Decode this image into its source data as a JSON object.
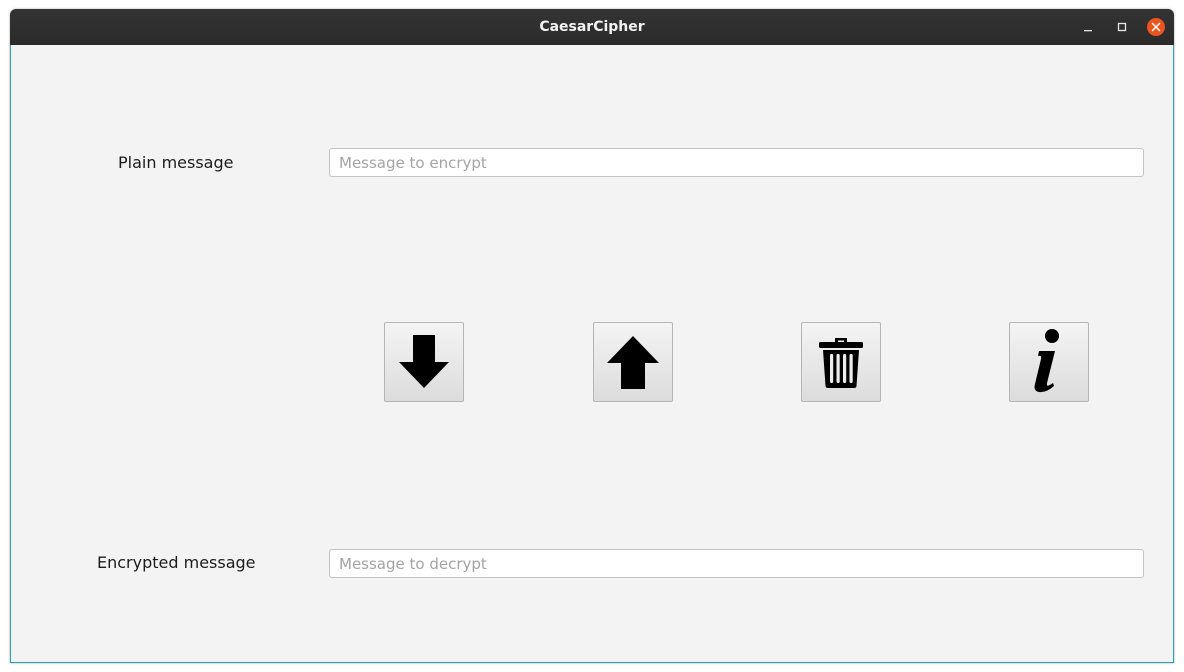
{
  "window": {
    "title": "CaesarCipher",
    "controls": {
      "minimize_icon": "minimize-icon",
      "maximize_icon": "maximize-icon",
      "close_icon": "close-icon",
      "close_color": "#e95420"
    },
    "border_color": "#2aa1b3"
  },
  "form": {
    "plain_label": "Plain message",
    "plain_placeholder": "Message to encrypt",
    "plain_value": "",
    "encrypted_label": "Encrypted message",
    "encrypted_placeholder": "Message to decrypt",
    "encrypted_value": ""
  },
  "actions": [
    {
      "name": "encrypt",
      "icon": "arrow-down-icon"
    },
    {
      "name": "decrypt",
      "icon": "arrow-up-icon"
    },
    {
      "name": "clear",
      "icon": "trash-icon"
    },
    {
      "name": "info",
      "icon": "info-icon"
    }
  ]
}
